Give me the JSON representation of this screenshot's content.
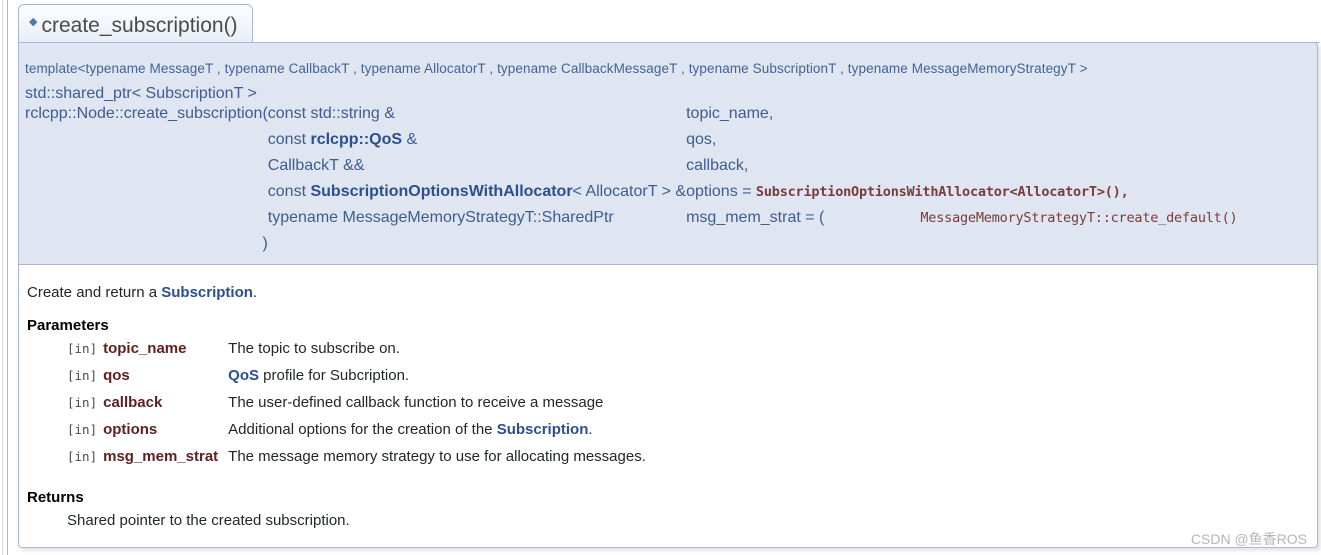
{
  "header": {
    "title": "create_subscription()",
    "permalink_icon": "diamond-icon"
  },
  "prototype": {
    "template_line": "template<typename MessageT , typename CallbackT , typename AllocatorT , typename CallbackMessageT , typename SubscriptionT , typename MessageMemoryStrategyT >",
    "return_type": "std::shared_ptr< SubscriptionT >",
    "function_name": "rclcpp::Node::create_subscription",
    "open_paren": "(",
    "close_paren": ")",
    "parameters": [
      {
        "type_prefix": "const ",
        "type_bold": "std::string",
        "type_suffix": " &",
        "name": "topic_name,",
        "default": "",
        "bold": false
      },
      {
        "type_prefix": "const ",
        "type_bold": "rclcpp::QoS",
        "type_suffix": " &",
        "name": "qos,",
        "default": "",
        "bold": true
      },
      {
        "type_prefix": "",
        "type_bold": "CallbackT",
        "type_suffix": " &&",
        "name": "callback,",
        "default": "",
        "bold": false
      },
      {
        "type_prefix": "const ",
        "type_bold": "SubscriptionOptionsWithAllocator",
        "type_suffix": "< AllocatorT > &",
        "name": "options = ",
        "default": "SubscriptionOptionsWithAllocator<AllocatorT>(),",
        "bold": true
      },
      {
        "type_prefix": "typename ",
        "type_bold": "MessageMemoryStrategyT::SharedPtr",
        "type_suffix": "",
        "name": "msg_mem_strat = (",
        "default": "MessageMemoryStrategyT::create_default()",
        "default_close": ")",
        "bold": false
      }
    ]
  },
  "documentation": {
    "description_pre": "Create and return a ",
    "description_link": "Subscription",
    "description_post": ".",
    "parameters_title": "Parameters",
    "parameters": [
      {
        "dir": "[in]",
        "name": "topic_name",
        "desc_pre": "The topic to subscribe on.",
        "desc_link": "",
        "desc_post": ""
      },
      {
        "dir": "[in]",
        "name": "qos",
        "desc_pre": "",
        "desc_link": "QoS",
        "desc_post": " profile for Subcription."
      },
      {
        "dir": "[in]",
        "name": "callback",
        "desc_pre": "The user-defined callback function to receive a message",
        "desc_link": "",
        "desc_post": ""
      },
      {
        "dir": "[in]",
        "name": "options",
        "desc_pre": "Additional options for the creation of the ",
        "desc_link": "Subscription",
        "desc_post": "."
      },
      {
        "dir": "[in]",
        "name": "msg_mem_strat",
        "desc_pre": "The message memory strategy to use for allocating messages.",
        "desc_link": "",
        "desc_post": ""
      }
    ],
    "returns_title": "Returns",
    "returns_body": "Shared pointer to the created subscription."
  },
  "watermark": "CSDN @鱼香ROS",
  "colors": {
    "proto_background": "#dfe5f1",
    "border": "#a8b8d9",
    "link": "#2d4f8e",
    "signature_text": "#3f5d8e",
    "default_value": "#7a3b3b",
    "param_name": "#602020"
  }
}
